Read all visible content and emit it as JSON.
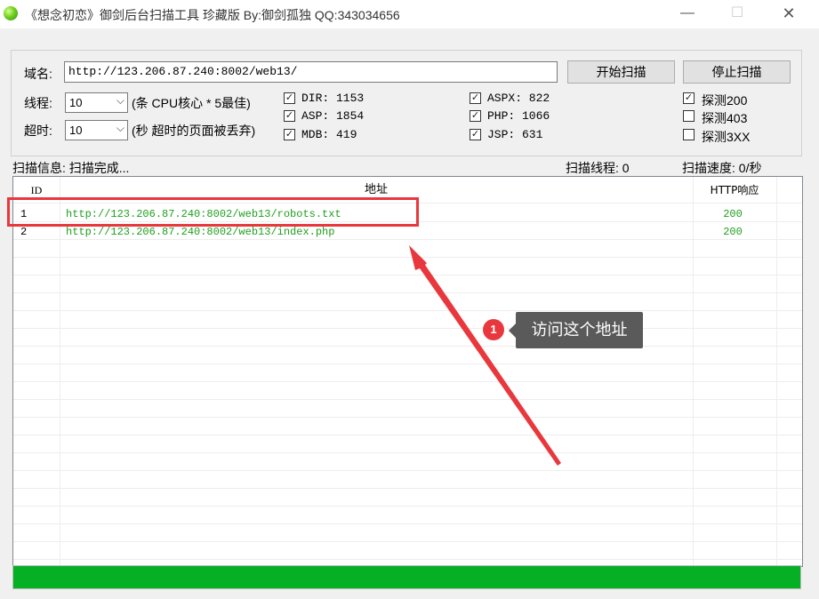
{
  "window": {
    "title": "《想念初恋》御剑后台扫描工具 珍藏版 By:御剑孤独 QQ:343034656",
    "minimize_glyph": "—",
    "maximize_glyph": "☐",
    "close_glyph": "✕"
  },
  "config": {
    "domain_label": "域名:",
    "domain_value": "http://123.206.87.240:8002/web13/",
    "start_button": "开始扫描",
    "stop_button": "停止扫描",
    "threads_label": "线程:",
    "threads_value": "10",
    "threads_hint": "(条 CPU核心 * 5最佳)",
    "timeout_label": "超时:",
    "timeout_value": "10",
    "timeout_hint": "(秒 超时的页面被丢弃)",
    "dicts": [
      {
        "label": "DIR: 1153",
        "checked": true
      },
      {
        "label": "ASP: 1854",
        "checked": true
      },
      {
        "label": "MDB: 419",
        "checked": true
      },
      {
        "label": "ASPX: 822",
        "checked": true
      },
      {
        "label": "PHP: 1066",
        "checked": true
      },
      {
        "label": "JSP: 631",
        "checked": true
      }
    ],
    "detect": [
      {
        "label": "探测200",
        "checked": true
      },
      {
        "label": "探测403",
        "checked": false
      },
      {
        "label": "探测3XX",
        "checked": false
      }
    ],
    "check_glyph": "✓"
  },
  "status": {
    "scan_info": "扫描信息: 扫描完成...",
    "scan_threads": "扫描线程: 0",
    "scan_speed": "扫描速度: 0/秒"
  },
  "table": {
    "headers": {
      "id": "ID",
      "address": "地址",
      "http": "HTTP响应"
    },
    "rows": [
      {
        "id": "1",
        "url": "http://123.206.87.240:8002/web13/robots.txt",
        "code": "200"
      },
      {
        "id": "2",
        "url": "http://123.206.87.240:8002/web13/index.php",
        "code": "200"
      }
    ]
  },
  "progress": {
    "percent": 100,
    "color": "#06b025"
  },
  "annotation": {
    "badge": "1",
    "text": "访问这个地址",
    "color": "#e8383d"
  }
}
